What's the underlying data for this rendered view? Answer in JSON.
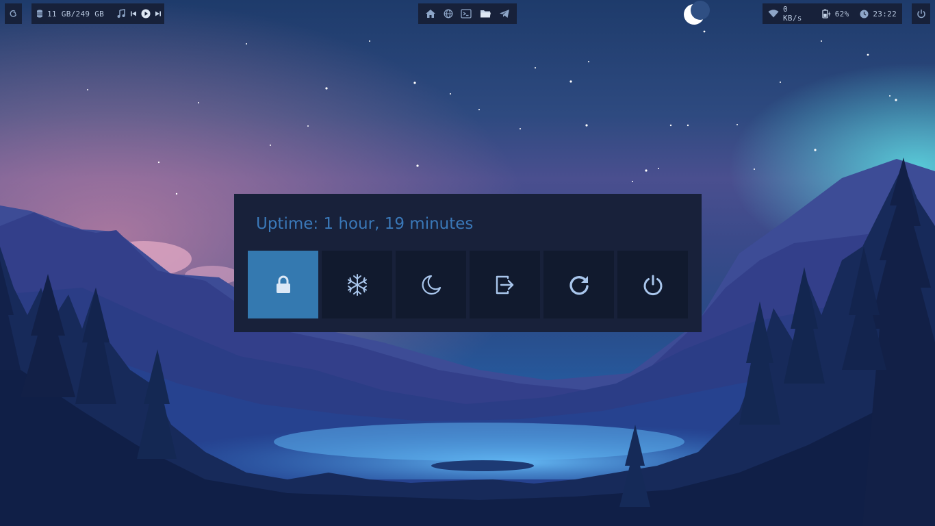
{
  "topbar": {
    "disk_usage": "11 GB/249 GB",
    "network_speed": "0 KB/s",
    "battery": "62%",
    "clock": "23:22"
  },
  "dock_icons": [
    "home-icon",
    "globe-icon",
    "terminal-icon",
    "folder-icon",
    "telegram-icon"
  ],
  "media_icons": [
    "music-icon",
    "previous-icon",
    "play-icon",
    "next-icon"
  ],
  "powermenu": {
    "uptime": "Uptime: 1 hour, 19 minutes",
    "options": [
      {
        "name": "lock",
        "icon": "lock-icon",
        "selected": true
      },
      {
        "name": "suspend",
        "icon": "snowflake-icon",
        "selected": false
      },
      {
        "name": "hibernate",
        "icon": "moon-icon",
        "selected": false
      },
      {
        "name": "logout",
        "icon": "logout-icon",
        "selected": false
      },
      {
        "name": "reboot",
        "icon": "reboot-icon",
        "selected": false
      },
      {
        "name": "shutdown",
        "icon": "power-icon",
        "selected": false
      }
    ]
  },
  "colors": {
    "bar_bg": "#17213a",
    "menu_bg": "#18213a",
    "option_bg": "#111a2e",
    "selected_bg": "#3479b0",
    "accent_text": "#3a78b8",
    "icon": "#a9c6ec"
  }
}
